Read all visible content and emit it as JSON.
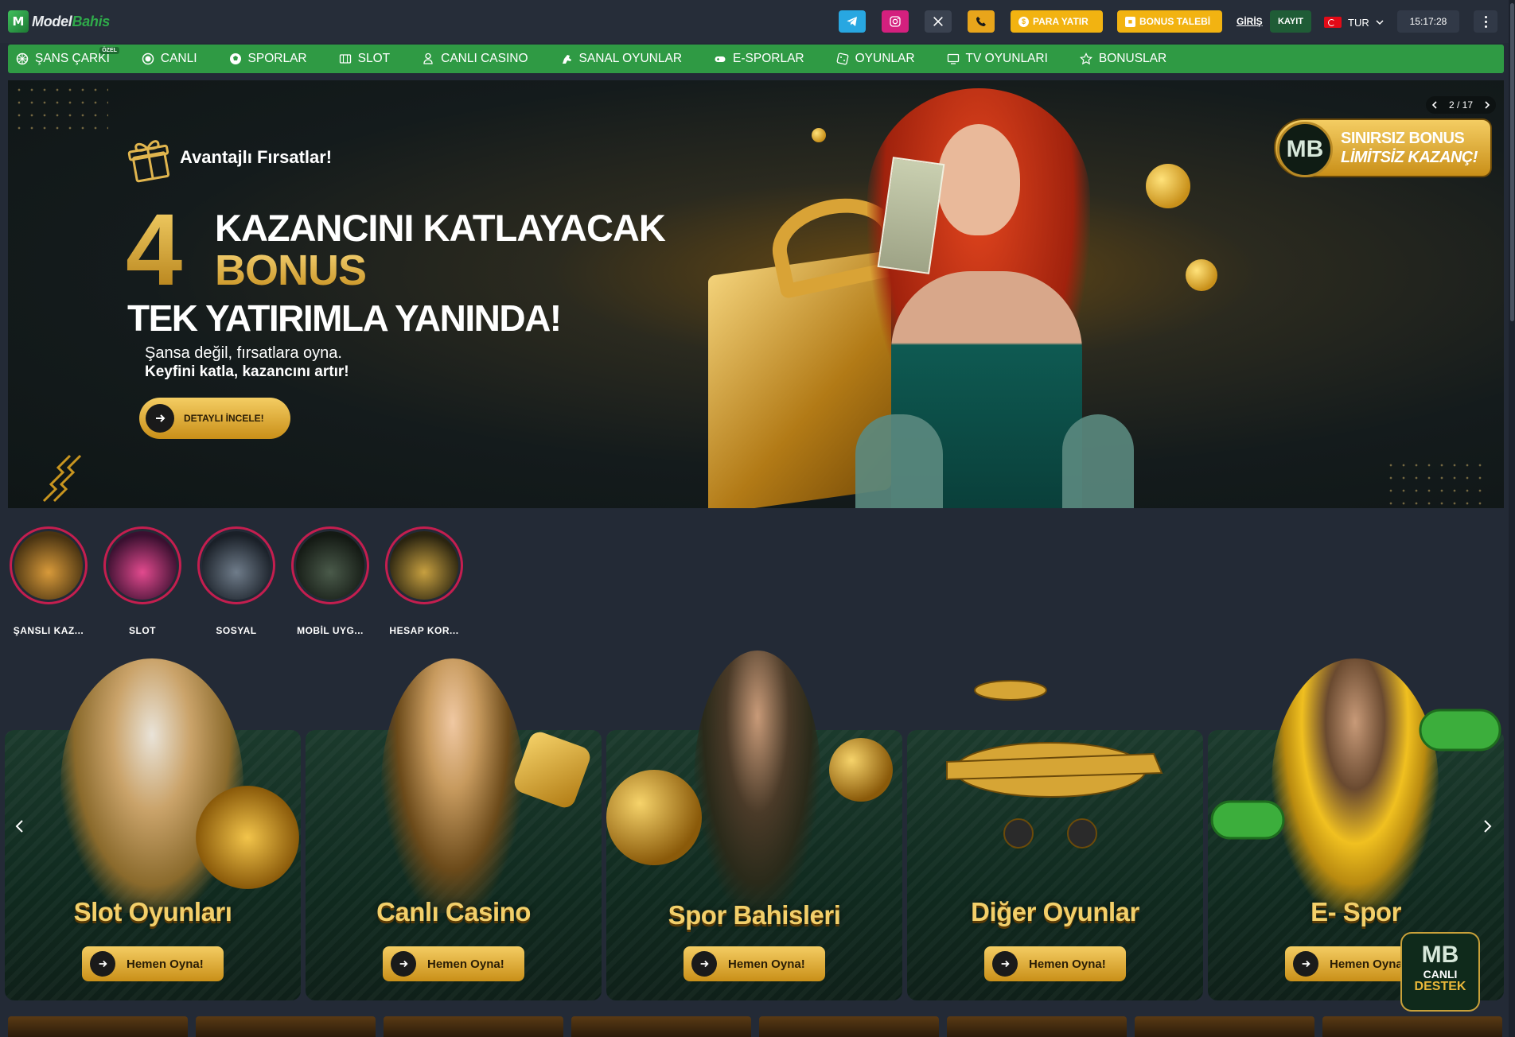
{
  "header": {
    "logo_part1": "Model",
    "logo_part2": "Bahis",
    "para_yatir": "PARA YATIR",
    "bonus_talebi": "BONUS TALEBİ",
    "giris": "GİRİŞ",
    "kayit": "KAYIT",
    "language": "TUR",
    "clock": "15:17:28"
  },
  "nav": {
    "items": [
      {
        "label": "ŞANS ÇARKI",
        "badge": "ÖZEL",
        "icon": "wheel-icon"
      },
      {
        "label": "CANLI",
        "icon": "live-icon"
      },
      {
        "label": "SPORLAR",
        "icon": "football-icon"
      },
      {
        "label": "SLOT",
        "icon": "slot-icon"
      },
      {
        "label": "CANLI CASINO",
        "icon": "dealer-icon"
      },
      {
        "label": "SANAL OYUNLAR",
        "icon": "horse-icon"
      },
      {
        "label": "E-SPORLAR",
        "icon": "gamepad-icon"
      },
      {
        "label": "OYUNLAR",
        "icon": "dice-icon"
      },
      {
        "label": "TV OYUNLARI",
        "icon": "tv-icon"
      },
      {
        "label": "BONUSLAR",
        "icon": "star-icon"
      }
    ]
  },
  "hero": {
    "eyebrow": "Avantajlı Fırsatlar!",
    "number": "4",
    "line1": "KAZANCINI KATLAYACAK",
    "line2": "BONUS",
    "line3": "TEK YATIRIMLA YANINDA!",
    "sub1": "Şansa değil, fırsatlara oyna.",
    "sub2": "Keyfini katla, kazancını artır!",
    "cta": "DETAYLI İNCELE!",
    "pager": "2 / 17",
    "badge_line1": "SINIRSIZ BONUS",
    "badge_line2": "LİMİTSİZ KAZANÇ!",
    "badge_logo": "MB"
  },
  "stories": [
    {
      "label": "ŞANSLI KAZ..."
    },
    {
      "label": "SLOT"
    },
    {
      "label": "SOSYAL"
    },
    {
      "label": "MOBİL UYG..."
    },
    {
      "label": "HESAP KOR..."
    }
  ],
  "categories": [
    {
      "title": "Slot Oyunları",
      "cta": "Hemen Oyna!"
    },
    {
      "title": "Canlı Casino",
      "cta": "Hemen Oyna!"
    },
    {
      "title": "Spor Bahisleri",
      "cta": "Hemen Oyna!"
    },
    {
      "title": "Diğer Oyunlar",
      "cta": "Hemen Oyna!"
    },
    {
      "title": "E- Spor",
      "cta": "Hemen Oyna!"
    }
  ],
  "support": {
    "logo": "MB",
    "line1": "CANLI",
    "line2": "DESTEK"
  },
  "colors": {
    "brand_green": "#2f9a44",
    "gold": "#f2b311",
    "background": "#232a36"
  }
}
